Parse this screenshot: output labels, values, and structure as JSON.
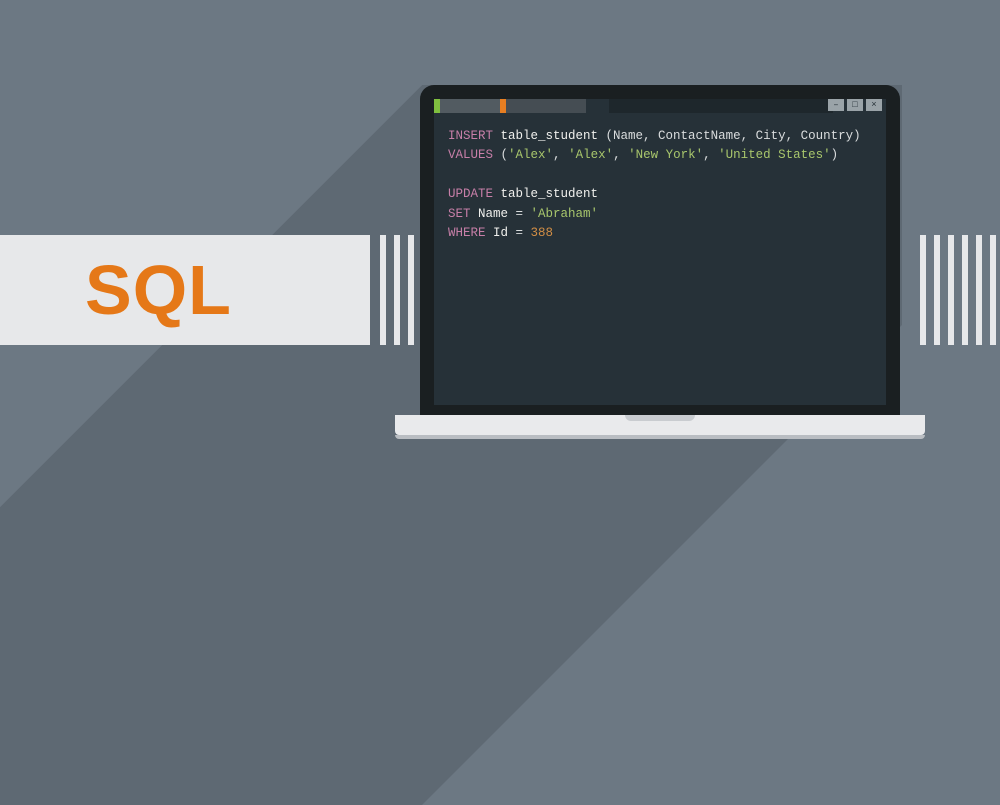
{
  "label": {
    "title": "SQL"
  },
  "window": {
    "controls": {
      "min": "–",
      "max": "□",
      "close": "×"
    }
  },
  "code": {
    "l1_kw1": "INSERT",
    "l1_table": " table_student ",
    "l1_cols": "(Name, ContactName, City, Country)",
    "l2_kw": "VALUES",
    "l2_vals_open": " (",
    "l2_v1": "'Alex'",
    "l2_sep": ", ",
    "l2_v2": "'Alex'",
    "l2_v3": "'New York'",
    "l2_v4": "'United States'",
    "l2_vals_close": ")",
    "l4_kw": "UPDATE",
    "l4_table": " table_student",
    "l5_kw": "SET",
    "l5_col": " Name ",
    "l5_eq": "= ",
    "l5_val": "'Abraham'",
    "l6_kw": "WHERE",
    "l6_col": " Id ",
    "l6_eq": "= ",
    "l6_val": "388"
  }
}
